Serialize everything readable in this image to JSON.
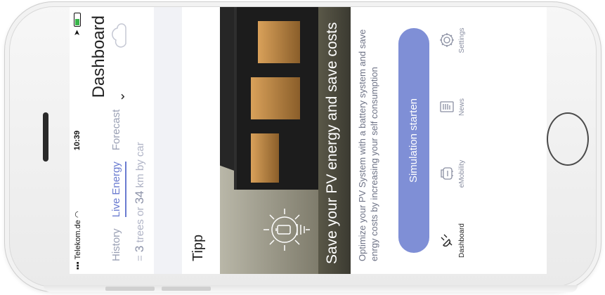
{
  "statusbar": {
    "carrier": "Telekom.de",
    "time": "10:39"
  },
  "header": {
    "title": "Dashboard"
  },
  "tabs": [
    {
      "label": "History",
      "active": false
    },
    {
      "label": "Live Energy",
      "active": true
    },
    {
      "label": "Forecast",
      "active": false
    }
  ],
  "equivalence": {
    "prefix": "= ",
    "trees": "3",
    "middle": " trees or ",
    "km": "34",
    "suffix": " km by car"
  },
  "tip": {
    "title": "Tipp",
    "hero_text": "Save your PV energy and  save costs",
    "description": "Optimize your PV System with a battery system and save enrgy costs by increasing your self consumption",
    "button_label": "Simulation starten"
  },
  "nav": {
    "items": [
      {
        "label": "Dashboard",
        "icon": "plug-icon",
        "active": true
      },
      {
        "label": "eMobility",
        "icon": "car-charger-icon",
        "active": false
      },
      {
        "label": "News",
        "icon": "newspaper-icon",
        "active": false
      },
      {
        "label": "Settings",
        "icon": "gear-icon",
        "active": false
      }
    ]
  },
  "colors": {
    "accent": "#6a7bd0",
    "button": "#7f8fd6",
    "muted_text": "#b0b4c6"
  }
}
